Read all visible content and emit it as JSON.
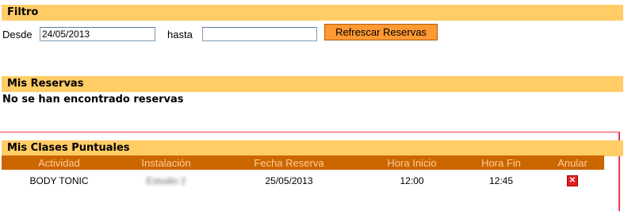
{
  "filtro": {
    "title": "Filtro",
    "desde_label": "Desde",
    "desde_value": "24/05/2013",
    "hasta_label": "hasta",
    "hasta_value": "",
    "refresh_label": "Refrescar Reservas"
  },
  "reservas": {
    "title": "Mis Reservas",
    "empty_message": "No se han encontrado reservas"
  },
  "clases": {
    "title": "Mis Clases Puntuales",
    "headers": [
      "Actividad",
      "Instalación",
      "Fecha Reserva",
      "Hora Inicio",
      "Hora Fin",
      "Anular"
    ],
    "rows": [
      {
        "actividad": "BODY TONIC",
        "instalacion": "Estudio 2",
        "fecha": "25/05/2013",
        "hora_inicio": "12:00",
        "hora_fin": "12:45",
        "anular_icon": "delete-icon"
      }
    ]
  },
  "colors": {
    "section_bar": "#ffcc66",
    "table_header": "#cc6600",
    "button": "#ff9933",
    "annotation_box": "#e8394e"
  }
}
